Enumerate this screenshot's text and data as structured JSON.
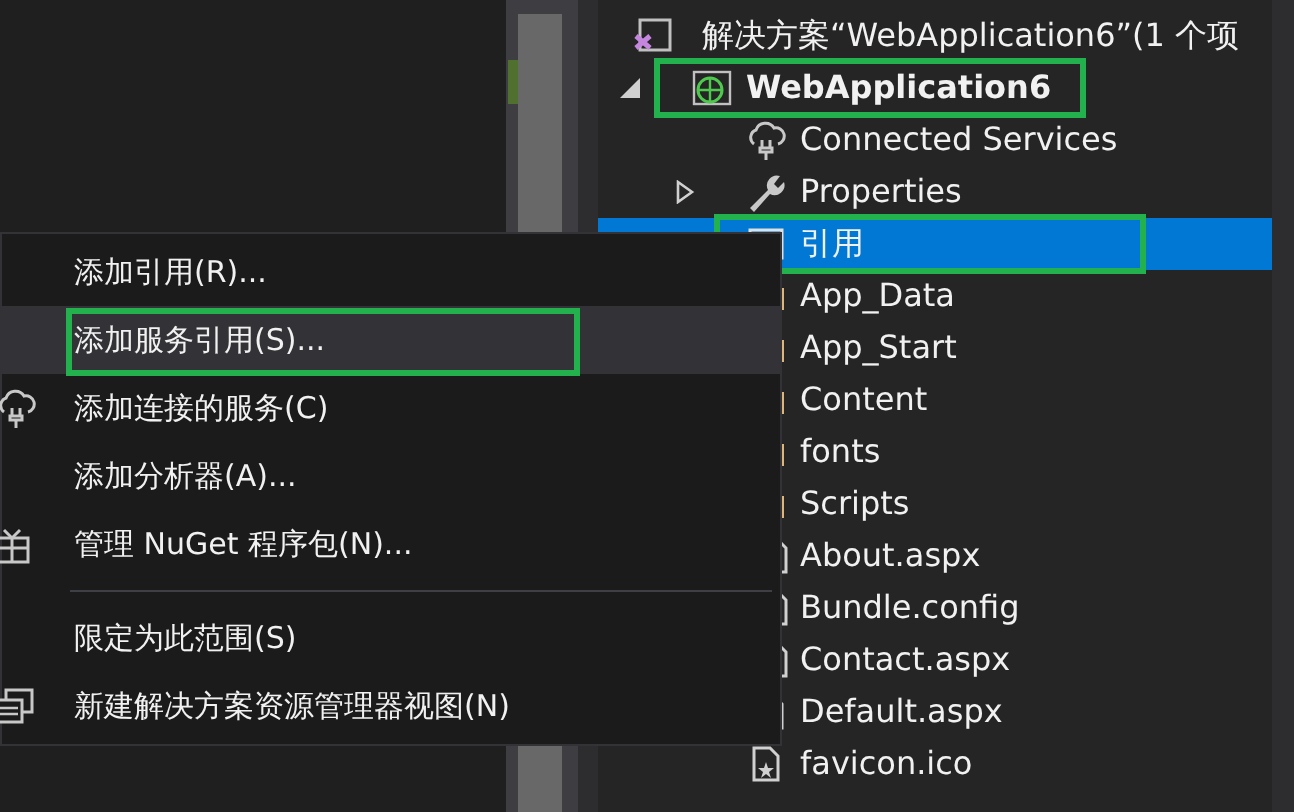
{
  "solution_explorer": {
    "solution": {
      "label": "解决方案“WebApplication6”(1 个项",
      "children": [
        {
          "label": "WebApplication6",
          "kind": "project",
          "expanded": true,
          "highlighted": true,
          "selected": false,
          "children": [
            {
              "label": "Connected Services",
              "kind": "connected-services",
              "selected": false
            },
            {
              "label": "Properties",
              "kind": "properties",
              "expanded": false,
              "selected": false
            },
            {
              "label": "引用",
              "kind": "references",
              "highlighted": true,
              "selected": true
            },
            {
              "label": "App_Data",
              "kind": "folder",
              "selected": false
            },
            {
              "label": "App_Start",
              "kind": "folder",
              "selected": false
            },
            {
              "label": "Content",
              "kind": "folder",
              "selected": false
            },
            {
              "label": "fonts",
              "kind": "folder",
              "selected": false
            },
            {
              "label": "Scripts",
              "kind": "folder",
              "selected": false
            },
            {
              "label": "About.aspx",
              "kind": "file",
              "selected": false
            },
            {
              "label": "Bundle.config",
              "kind": "file",
              "selected": false
            },
            {
              "label": "Contact.aspx",
              "kind": "file",
              "selected": false
            },
            {
              "label": "Default.aspx",
              "kind": "web-page",
              "selected": false
            },
            {
              "label": "favicon.ico",
              "kind": "image-file",
              "selected": false
            }
          ]
        }
      ]
    }
  },
  "context_menu": {
    "items": [
      {
        "kind": "item",
        "label": "添加引用(R)...",
        "hovered": false
      },
      {
        "kind": "item",
        "label": "添加服务引用(S)...",
        "hovered": true,
        "highlighted": true
      },
      {
        "kind": "connected-services",
        "label": "添加连接的服务(C)",
        "hovered": false
      },
      {
        "kind": "item",
        "label": "添加分析器(A)...",
        "hovered": false
      },
      {
        "kind": "nuget",
        "label": "管理 NuGet 程序包(N)...",
        "hovered": false
      },
      {
        "kind": "separator"
      },
      {
        "kind": "item",
        "label": "限定为此范围(S)",
        "hovered": false
      },
      {
        "kind": "new-view",
        "label": "新建解决方案资源管理器视图(N)",
        "hovered": false
      }
    ]
  }
}
